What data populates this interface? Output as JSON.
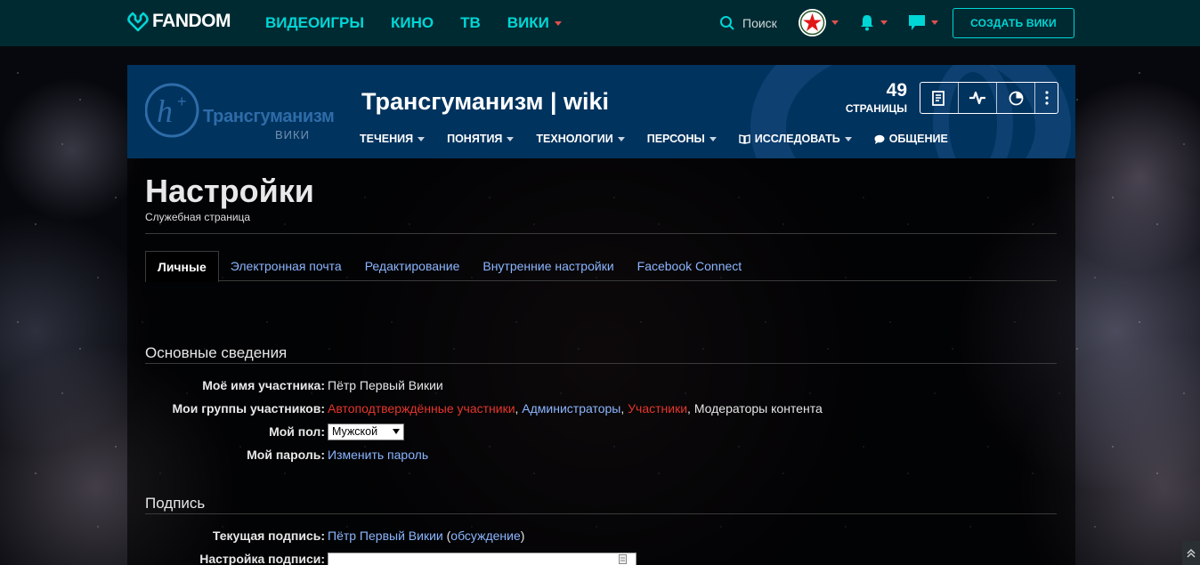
{
  "topbar": {
    "brand": "FANDOM",
    "nav": [
      {
        "label": "ВИДЕОИГРЫ"
      },
      {
        "label": "КИНО"
      },
      {
        "label": "ТВ"
      },
      {
        "label": "ВИКИ"
      }
    ],
    "search_label": "Поиск",
    "create_wiki": "СОЗДАТЬ ВИКИ",
    "accent": "#00d6d6",
    "bg": "#002a32"
  },
  "wiki": {
    "logo_text": "Трансгуманизм",
    "logo_sub": "ВИКИ",
    "title": "Трансгуманизм | wiki",
    "pages_count": "49",
    "pages_label": "СТРАНИЦЫ",
    "nav": [
      {
        "label": "ТЕЧЕНИЯ"
      },
      {
        "label": "ПОНЯТИЯ"
      },
      {
        "label": "ТЕХНОЛОГИИ"
      },
      {
        "label": "ПЕРСОНЫ"
      },
      {
        "label": "ИССЛЕДОВАТЬ"
      },
      {
        "label": "ОБЩЕНИЕ"
      }
    ]
  },
  "page": {
    "title": "Настройки",
    "subtitle": "Служебная страница"
  },
  "tabs": [
    {
      "label": "Личные"
    },
    {
      "label": "Электронная почта"
    },
    {
      "label": "Редактирование"
    },
    {
      "label": "Внутренние настройки"
    },
    {
      "label": "Facebook Connect"
    }
  ],
  "basic": {
    "heading": "Основные сведения",
    "username_label": "Моё имя участника:",
    "username_value": "Пётр Первый Викии",
    "groups_label": "Мои группы участников:",
    "groups": {
      "g1": "Автоподтверждённые участники",
      "g2": "Администраторы",
      "g3": "Участники",
      "g4": "Модераторы контента"
    },
    "gender_label": "Мой пол:",
    "gender_value": "Мужской",
    "password_label": "Мой пароль:",
    "password_link": "Изменить пароль"
  },
  "signature": {
    "heading": "Подпись",
    "current_label": "Текущая подпись:",
    "current_name": "Пётр Первый Викии",
    "talk_link": "обсуждение",
    "settings_label": "Настройка подписи:"
  }
}
